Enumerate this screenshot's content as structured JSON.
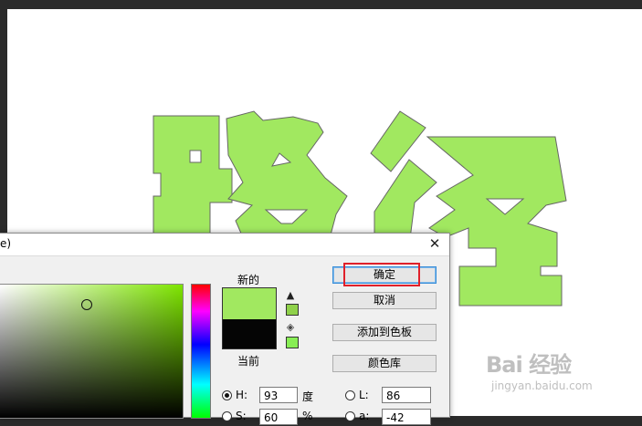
{
  "canvas": {
    "text_color": "#a1e860",
    "chars": [
      "路",
      "径"
    ]
  },
  "dialog": {
    "title": "e)",
    "close_glyph": "✕",
    "label_new": "新的",
    "label_current": "当前",
    "new_color": "#a1e860",
    "current_color": "#050505",
    "buttons": {
      "ok": "确定",
      "cancel": "取消",
      "add_to_swatches": "添加到色板",
      "color_libraries": "颜色库"
    },
    "fields": {
      "h": {
        "label": "H:",
        "value": "93",
        "unit": "度"
      },
      "s": {
        "label": "S:",
        "value": "60",
        "unit": "%"
      },
      "l": {
        "label": "L:",
        "value": "86"
      },
      "a": {
        "label": "a:",
        "value": "-42"
      }
    },
    "icons": {
      "gamut_warning": "warning-icon",
      "web_safe": "cube-icon"
    }
  },
  "watermark": {
    "logo": "Bai 经验",
    "sub": "jingyan.baidu.com"
  }
}
